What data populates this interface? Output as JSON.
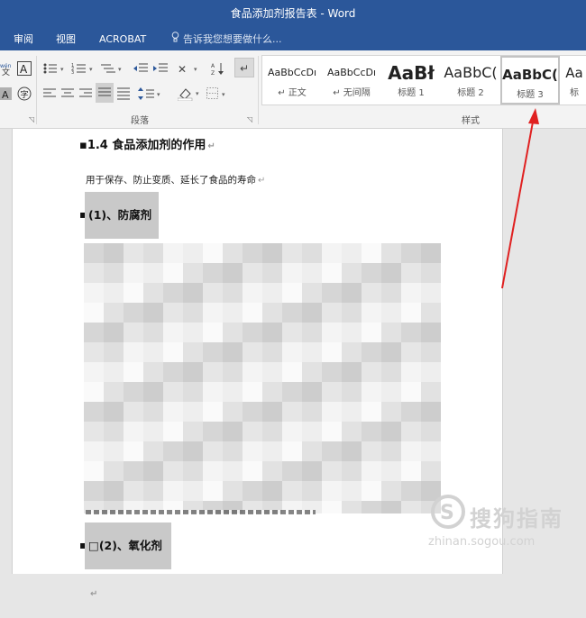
{
  "window": {
    "title": "食品添加剂报告表 - Word"
  },
  "tabs": [
    "审阅",
    "视图",
    "ACROBAT"
  ],
  "tell_me": {
    "placeholder": "告诉我您想要做什么..."
  },
  "ribbon": {
    "paragraph_group_label": "段落",
    "styles_group_label": "样式",
    "styles": [
      {
        "preview": "AaBbCcDı",
        "name": "↵ 正文"
      },
      {
        "preview": "AaBbCcDı",
        "name": "↵ 无间隔"
      },
      {
        "preview": "AaBł",
        "name": "标题 1"
      },
      {
        "preview": "AaBbC(",
        "name": "标题 2"
      },
      {
        "preview": "AaBbC(",
        "name": "标题 3",
        "selected": true
      },
      {
        "preview": "Aa",
        "name": "标"
      }
    ]
  },
  "document": {
    "heading": "1.4 食品添加剂的作用",
    "body": "用于保存、防止变质、延长了食品的寿命",
    "section1": "(1)、防腐剂",
    "section2": "(2)、氧化剂",
    "section2_prefix": "□"
  },
  "watermark": {
    "title": "搜狗指南",
    "url": "zhinan.sogou.com"
  },
  "colors": {
    "accent": "#2b579a",
    "arrow": "#e02020",
    "highlight": "#c9c9c9"
  }
}
